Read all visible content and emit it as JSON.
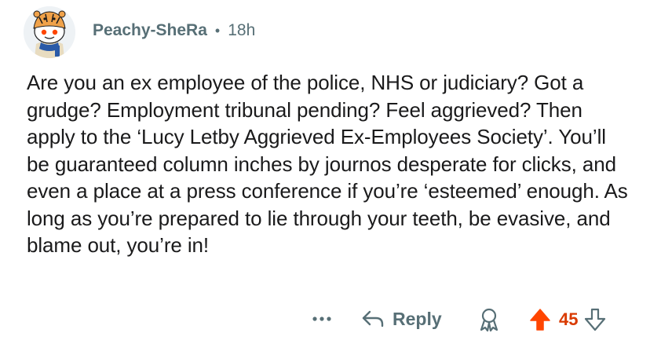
{
  "comment": {
    "author": "Peachy-SheRa",
    "separator": "•",
    "age": "18h",
    "body": "Are you an ex employee of the police, NHS or judiciary? Got a grudge? Employment tribunal pending? Feel aggrieved? Then apply to the ‘Lucy Letby Aggrieved Ex-Employees Society’. You’ll be guaranteed column inches by journos desperate for clicks, and even a place at a press conference if you’re ‘esteemed’ enough. As long as you’re prepared to lie through your teeth, be evasive, and blame out, you’re in!",
    "avatar_icon": "tiger-snoo-avatar-icon"
  },
  "actions": {
    "more_icon": "ellipsis-icon",
    "reply_icon": "reply-arrow-icon",
    "reply_label": "Reply",
    "award_icon": "award-icon",
    "upvote_icon": "upvote-arrow-icon",
    "score": "45",
    "downvote_icon": "downvote-arrow-icon"
  },
  "colors": {
    "text": "#1a1a1b",
    "meta": "#576f76",
    "upvote_active": "#d93a00"
  }
}
